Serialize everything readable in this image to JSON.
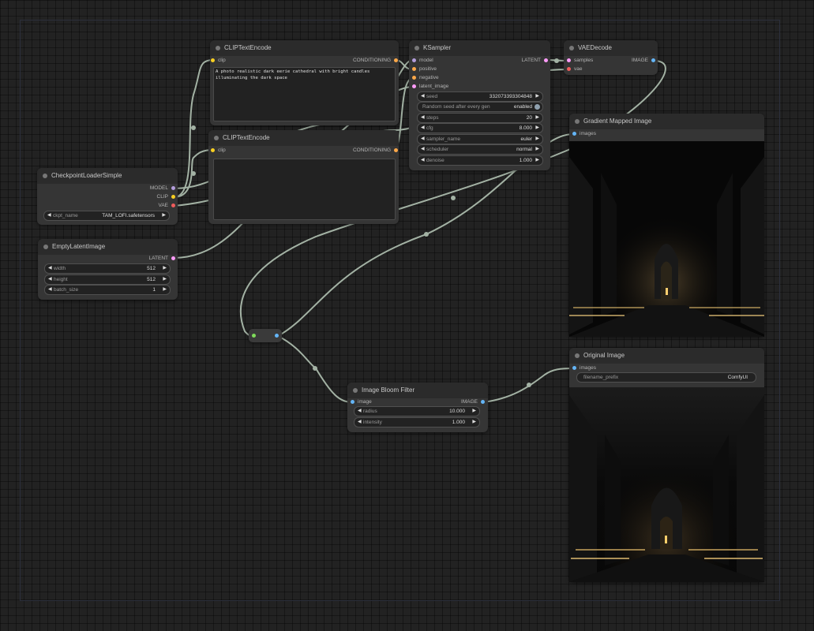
{
  "nodes": {
    "clip_text_1": {
      "title": "CLIPTextEncode",
      "input_clip": "clip",
      "output_conditioning": "CONDITIONING",
      "text": "A photo realistic dark eerie cathedral with bright candles illuminating the dark space"
    },
    "clip_text_2": {
      "title": "CLIPTextEncode",
      "input_clip": "clip",
      "output_conditioning": "CONDITIONING",
      "text": ""
    },
    "ksampler": {
      "title": "KSampler",
      "inputs": {
        "model": "model",
        "positive": "positive",
        "negative": "negative",
        "latent_image": "latent_image"
      },
      "output_latent": "LATENT",
      "widgets": {
        "seed_label": "seed",
        "seed": "332073393304848",
        "random_seed_label": "Random seed after every gen",
        "random_seed": "enabled",
        "steps_label": "steps",
        "steps": "20",
        "cfg_label": "cfg",
        "cfg": "8.000",
        "sampler_name_label": "sampler_name",
        "sampler_name": "euler",
        "scheduler_label": "scheduler",
        "scheduler": "normal",
        "denoise_label": "denoise",
        "denoise": "1.000"
      }
    },
    "vae_decode": {
      "title": "VAEDecode",
      "input_samples": "samples",
      "input_vae": "vae",
      "output_image": "IMAGE"
    },
    "gradient_mapped": {
      "title": "Gradient Mapped Image",
      "input_images": "images"
    },
    "checkpoint_loader": {
      "title": "CheckpointLoaderSimple",
      "output_model": "MODEL",
      "output_clip": "CLIP",
      "output_vae": "VAE",
      "ckpt_name_label": "ckpt_name",
      "ckpt_name": "TAM_LOFI.safetensors"
    },
    "empty_latent": {
      "title": "EmptyLatentImage",
      "output_latent": "LATENT",
      "width_label": "width",
      "width": "512",
      "height_label": "height",
      "height": "512",
      "batch_size_label": "batch_size",
      "batch_size": "1"
    },
    "bloom": {
      "title": "Image Bloom Filter",
      "input_image": "image",
      "output_image": "IMAGE",
      "radius_label": "radius",
      "radius": "10.000",
      "intensity_label": "intensity",
      "intensity": "1.000"
    },
    "original_image": {
      "title": "Original Image",
      "input_images": "images",
      "filename_prefix_label": "filename_prefix",
      "filename_prefix": "ComfyUI"
    }
  },
  "colors": {
    "canvas": "#222222",
    "node_body": "#353535",
    "node_title": "#2b2b2b",
    "wire": "#a3b2a4",
    "clip": "#f8cf22",
    "conditioning": "#fca849",
    "model": "#b39ddb",
    "vae": "#ef5c5c",
    "latent": "#ff9cf9",
    "image": "#64b5f6"
  }
}
